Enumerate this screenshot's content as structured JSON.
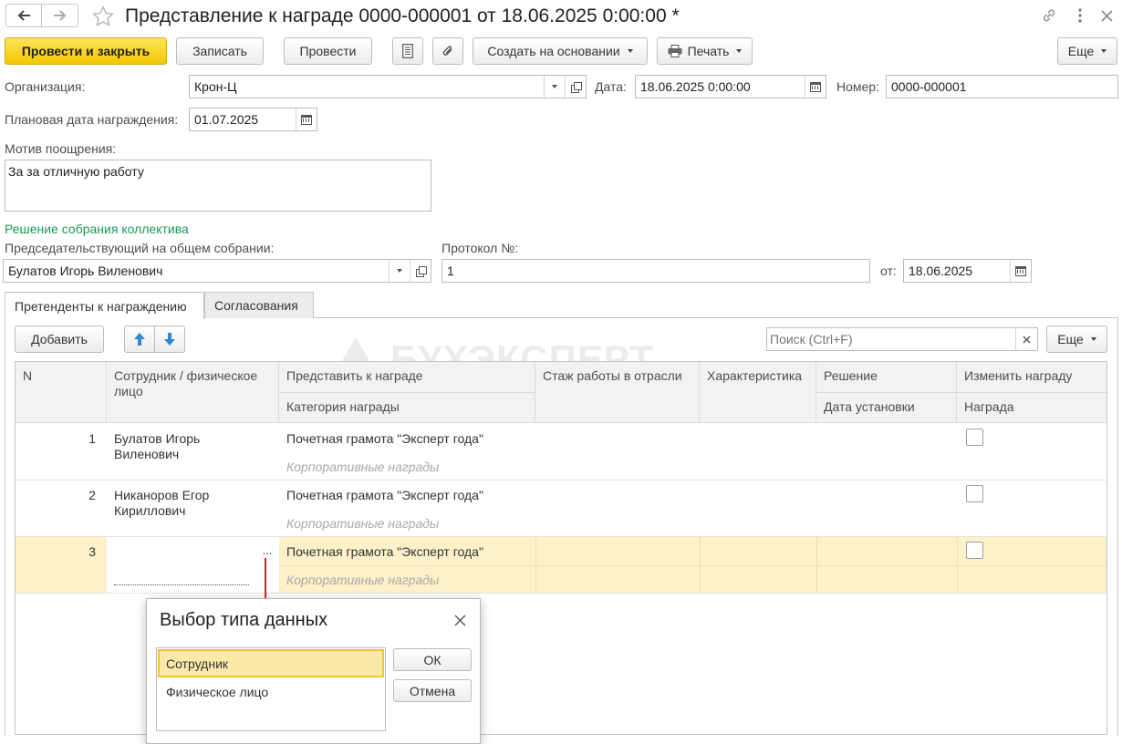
{
  "titlebar": {
    "title": "Представление к награде 0000-000001 от 18.06.2025 0:00:00 *"
  },
  "toolbar": {
    "post_close": "Провести и закрыть",
    "save": "Записать",
    "post": "Провести",
    "create_based": "Создать на основании",
    "print": "Печать",
    "more": "Еще"
  },
  "form": {
    "org_label": "Организация:",
    "org_value": "Крон-Ц",
    "date_label": "Дата:",
    "date_value": "18.06.2025  0:00:00",
    "number_label": "Номер:",
    "number_value": "0000-000001",
    "planned_label": "Плановая дата награждения:",
    "planned_value": "01.07.2025",
    "motive_label": "Мотив поощрения:",
    "motive_value": "За за отличную работу",
    "section_title": "Решение собрания коллектива",
    "chair_label": "Председательствующий на общем собрании:",
    "chair_value": "Булатов Игорь Виленович",
    "protocol_label": "Протокол №:",
    "protocol_value": "1",
    "from_label": "от:",
    "from_value": "18.06.2025"
  },
  "tabs": [
    {
      "label": "Претенденты к награждению"
    },
    {
      "label": "Согласования"
    }
  ],
  "table_toolbar": {
    "add": "Добавить",
    "search_placeholder": "Поиск (Ctrl+F)",
    "more": "Еще"
  },
  "watermark": "БУХЭКСПЕРТ",
  "table": {
    "headers": {
      "n": "N",
      "employee": "Сотрудник / физическое лицо",
      "present": "Представить к награде",
      "category": "Категория награды",
      "experience": "Стаж работы в отрасли",
      "characteristic": "Характеристика",
      "decision": "Решение",
      "set_date": "Дата установки",
      "change": "Изменить награду",
      "award": "Награда"
    },
    "rows": [
      {
        "n": "1",
        "employee": "Булатов Игорь Виленович",
        "award": "Почетная грамота \"Эксперт года\"",
        "category": "Корпоративные награды"
      },
      {
        "n": "2",
        "employee": "Никаноров Егор Кириллович",
        "award": "Почетная грамота \"Эксперт года\"",
        "category": "Корпоративные награды"
      },
      {
        "n": "3",
        "employee": "",
        "award": "Почетная грамота \"Эксперт года\"",
        "category": "Корпоративные награды"
      }
    ],
    "select_button": "..."
  },
  "dialog": {
    "title": "Выбор типа данных",
    "options": [
      "Сотрудник",
      "Физическое лицо"
    ],
    "ok": "ОК",
    "cancel": "Отмена"
  },
  "colors": {
    "accent": "#f3c800",
    "selected_row": "#fcf1c9",
    "section_title": "#1a9b55",
    "arrow": "#d62020"
  }
}
